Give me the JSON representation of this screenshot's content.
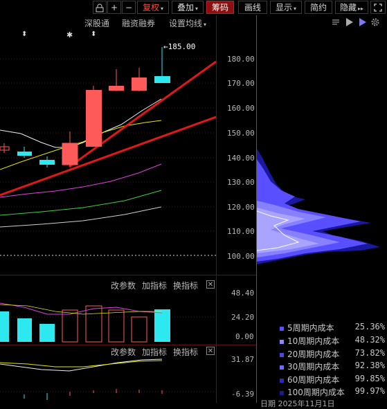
{
  "toolbar": {
    "buttons": [
      {
        "label": "复权",
        "caret": "▾",
        "red": true,
        "active": false
      },
      {
        "label": "叠加",
        "caret": "▾",
        "red": false,
        "active": false
      },
      {
        "label": "筹码",
        "caret": "",
        "red": false,
        "active": true
      },
      {
        "label": "画线",
        "caret": "",
        "red": false,
        "active": false
      },
      {
        "label": "显示",
        "caret": "▾",
        "red": false,
        "active": false
      },
      {
        "label": "简约",
        "caret": "",
        "red": false,
        "active": false
      },
      {
        "label": "隐藏",
        "caret": "▸▸",
        "red": false,
        "active": false
      }
    ],
    "icons": [
      "lock-icon",
      "plus-icon",
      "minus-icon",
      "fullscreen-icon"
    ]
  },
  "submenu": {
    "items": [
      "深股通",
      "融资融券",
      "设置均线"
    ],
    "caret": "▾",
    "markers": [
      "⬍",
      "✱",
      "⬍"
    ]
  },
  "main_chart": {
    "price_axis": [
      "180.00",
      "170.00",
      "160.00",
      "150.00",
      "140.00",
      "130.00",
      "120.00",
      "110.00",
      "100.00"
    ],
    "high_marker": "←185.00"
  },
  "volume_panel": {
    "menu": [
      "改参数",
      "加指标",
      "换指标"
    ],
    "close": "✕",
    "axis": [
      "48.40",
      "24.20",
      "0.00"
    ]
  },
  "macd_panel": {
    "menu": [
      "改参数",
      "加指标",
      "换指标"
    ],
    "close": "✕",
    "axis": [
      "31.87",
      "-6.39"
    ]
  },
  "chip_legend": [
    {
      "label": "5周期内成本",
      "value": "25.36%",
      "color": "#5a4fff"
    },
    {
      "label": "10周期内成本",
      "value": "48.32%",
      "color": "#8d86ff"
    },
    {
      "label": "20周期内成本",
      "value": "73.82%",
      "color": "#4a48e0"
    },
    {
      "label": "30周期内成本",
      "value": "92.38%",
      "color": "#6f6bff"
    },
    {
      "label": "60周期内成本",
      "value": "99.85%",
      "color": "#2d2ab8"
    },
    {
      "label": "100周期内成本",
      "value": "99.97%",
      "color": "#1d1a8a"
    }
  ],
  "bottom_text": "日期 2025年11月1日"
}
